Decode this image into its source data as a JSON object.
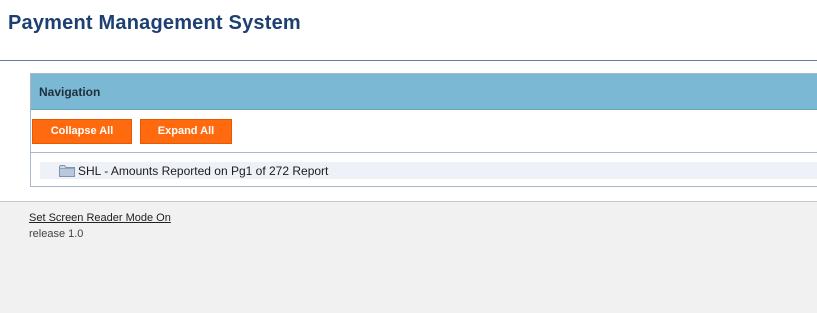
{
  "header": {
    "title": "Payment Management System"
  },
  "navigation": {
    "title": "Navigation",
    "collapse_label": "Collapse All",
    "expand_label": "Expand All",
    "tree": {
      "items": [
        {
          "label": "SHL - Amounts Reported on Pg1 of 272 Report",
          "icon": "folder-icon"
        }
      ]
    }
  },
  "footer": {
    "screen_reader_link": "Set Screen Reader Mode On",
    "release": "release 1.0"
  },
  "colors": {
    "title": "#1d3f72",
    "nav_header": "#7bb8d4",
    "button": "#ff6a0e",
    "tree_row": "#eef2f8",
    "footer_bg": "#f1f1f1"
  }
}
